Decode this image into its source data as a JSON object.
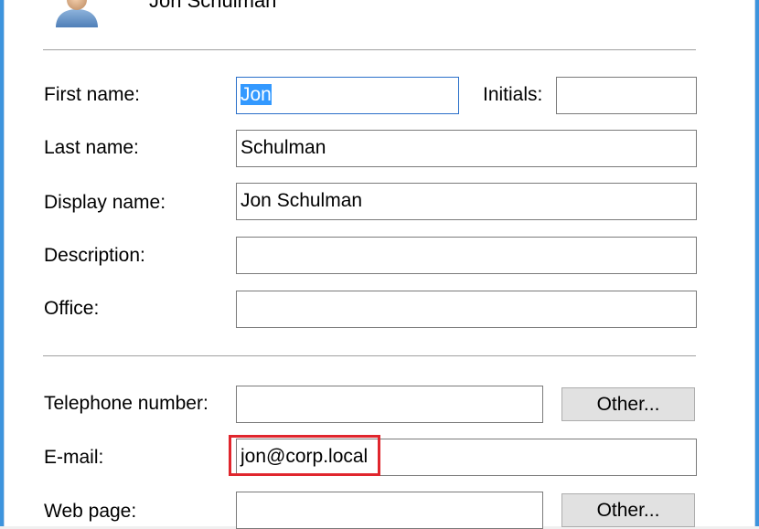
{
  "header": {
    "user_name": "Jon Schulman"
  },
  "form": {
    "first_name_label": "First name:",
    "first_name_value": "Jon",
    "initials_label": "Initials:",
    "initials_value": "",
    "last_name_label": "Last name:",
    "last_name_value": "Schulman",
    "display_name_label": "Display name:",
    "display_name_value": "Jon Schulman",
    "description_label": "Description:",
    "description_value": "",
    "office_label": "Office:",
    "office_value": "",
    "telephone_label": "Telephone number:",
    "telephone_value": "",
    "telephone_other_label": "Other...",
    "email_label": "E-mail:",
    "email_value": "jon@corp.local",
    "webpage_label": "Web page:",
    "webpage_value": "",
    "webpage_other_label": "Other..."
  },
  "colors": {
    "window_border": "#3d94dd",
    "focus_border": "#2a6fc9",
    "selection": "#3399ff",
    "annotation": "#e0262d"
  },
  "icons": {
    "avatar": "user-avatar-icon"
  }
}
